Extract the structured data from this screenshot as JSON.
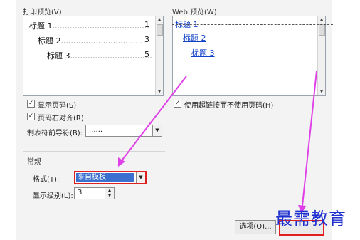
{
  "print_preview": {
    "label": "打印预览(V)",
    "entries": [
      {
        "text": "标题 1.......................................",
        "page": "1"
      },
      {
        "text": "标题 2..................................",
        "page": "3"
      },
      {
        "text": "标题 3.................................",
        "page": "5"
      }
    ]
  },
  "web_preview": {
    "label": "Web 预览(W)",
    "links": [
      "标题 1",
      "标题 2",
      "标题 3"
    ]
  },
  "options": {
    "show_page_numbers": "显示页码(S)",
    "right_align_page_numbers": "页码右对齐(R)",
    "tab_leader_label": "制表符前导符(B):",
    "tab_leader_value": "......",
    "use_hyperlinks": "使用超链接而不使用页码(H)"
  },
  "general": {
    "section_label": "常规",
    "format_label": "格式(T):",
    "format_value": "来自模板",
    "levels_label": "显示级别(L):",
    "levels_value": "3"
  },
  "buttons": {
    "options": "选项(O)..."
  },
  "watermark": "最需教育",
  "colors": {
    "arrow": "#e040e8",
    "highlight": "#e02020",
    "selection": "#3b6fd0"
  }
}
